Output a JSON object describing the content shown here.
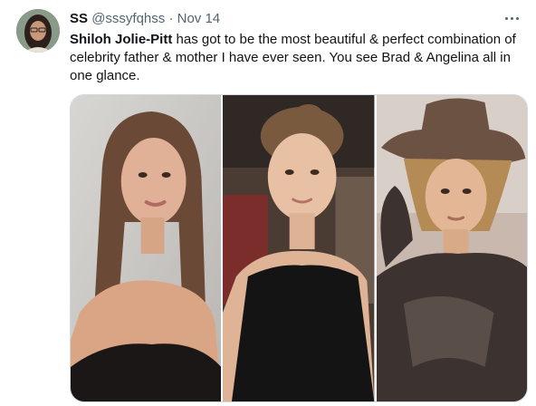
{
  "tweet": {
    "display_name": "SS",
    "handle": "@sssyfqhss",
    "separator": "·",
    "date": "Nov 14",
    "mention": "Shiloh Jolie-Pitt",
    "text_rest": " has got to be the most beautiful & perfect combination of celebrity father & mother I have ever seen. You see Brad & Angelina all in one glance."
  },
  "icons": {
    "more": "more-horizontal-icon",
    "avatar": "user-avatar"
  },
  "media": {
    "photos": [
      {
        "subject": "woman-with-long-brown-hair-black-strapless-top"
      },
      {
        "subject": "young-woman-hair-up-black-top"
      },
      {
        "subject": "young-man-brown-hat-leather-jacket"
      }
    ]
  },
  "colors": {
    "text": "#0f1419",
    "secondary": "#536471",
    "border": "#cfd9de"
  }
}
